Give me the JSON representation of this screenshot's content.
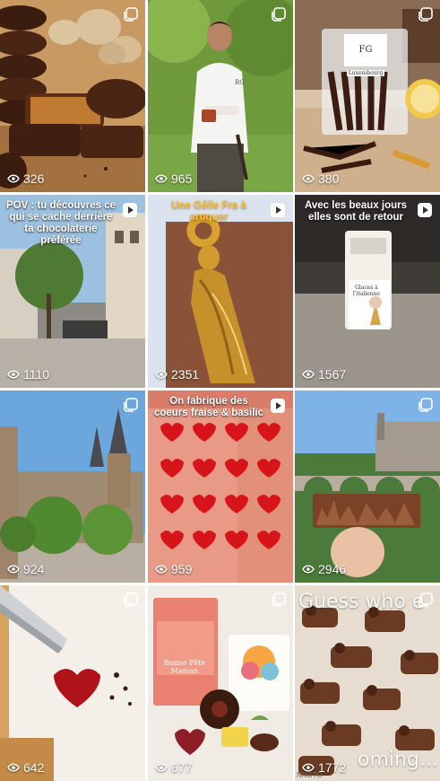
{
  "tiles": [
    {
      "views": "326",
      "type": "carousel"
    },
    {
      "views": "965",
      "type": "carousel",
      "logo": "RG"
    },
    {
      "views": "380",
      "type": "carousel",
      "box_label": "Luxembourg"
    },
    {
      "views": "1110",
      "type": "reel",
      "caption": "POV : tu découvres ce qui se cache derrière ta chocolaterie préférée"
    },
    {
      "views": "2351",
      "type": "reel",
      "caption": "Une Gêlle Fra à croquer"
    },
    {
      "views": "1567",
      "type": "reel",
      "caption": "Avec les beaux jours elles sont de retour",
      "sign": "Glaces à l'italienne"
    },
    {
      "views": "924",
      "type": "carousel"
    },
    {
      "views": "959",
      "type": "reel",
      "caption": "On fabrique des coeurs fraise & basilic"
    },
    {
      "views": "2946",
      "type": "carousel"
    },
    {
      "views": "642",
      "type": "carousel"
    },
    {
      "views": "677",
      "type": "carousel",
      "box_text": "Bonne Fête Maman"
    },
    {
      "views": "1772",
      "type": "carousel",
      "overlay_top": "Guess who e",
      "overlay_bottom": "oming...",
      "watermark": "NNOTO"
    }
  ],
  "colors": {
    "background": "#ffffff",
    "text": "#ffffff"
  },
  "icons": {
    "carousel": "carousel-icon",
    "reel": "reel-icon",
    "views": "eye-icon"
  }
}
